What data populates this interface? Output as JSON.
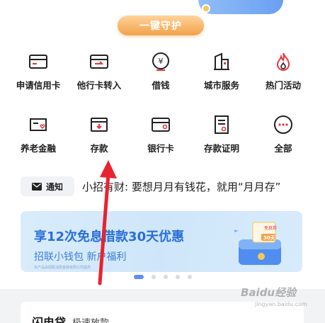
{
  "guard_button": "一键守护",
  "services": [
    {
      "label": "申请信用卡",
      "icon": "credit-card-icon"
    },
    {
      "label": "他行卡转入",
      "icon": "card-transfer-icon"
    },
    {
      "label": "借钱",
      "icon": "yuan-coin-icon"
    },
    {
      "label": "城市服务",
      "icon": "city-building-icon"
    },
    {
      "label": "热门活动",
      "icon": "flame-icon"
    },
    {
      "label": "养老金融",
      "icon": "pension-card-icon"
    },
    {
      "label": "存款",
      "icon": "deposit-icon"
    },
    {
      "label": "银行卡",
      "icon": "bank-card-icon"
    },
    {
      "label": "存款证明",
      "icon": "deposit-certificate-icon"
    },
    {
      "label": "全部",
      "icon": "more-dots-icon"
    }
  ],
  "notice": {
    "badge": "通知",
    "text": "小招有财: 要想月月有钱花，就用“月月存”"
  },
  "banner": {
    "title": "享12次免息借款30天优惠",
    "subtitle": "招联小钱包 新户福利",
    "footnote": "本产品由招联消费金融有限公司提供",
    "tag_text": "免息券",
    "tag_value": "30天"
  },
  "bottom": {
    "title": "闪电贷",
    "subtitle": "极速放款"
  },
  "watermark": {
    "main": "Baidu经验",
    "sub": "jingyan.baidu.com"
  },
  "colors": {
    "accent_orange": "#f2a24a",
    "banner_blue": "#2a6fd8",
    "arrow_red": "#e8232f",
    "icon_red": "#e8353f"
  }
}
